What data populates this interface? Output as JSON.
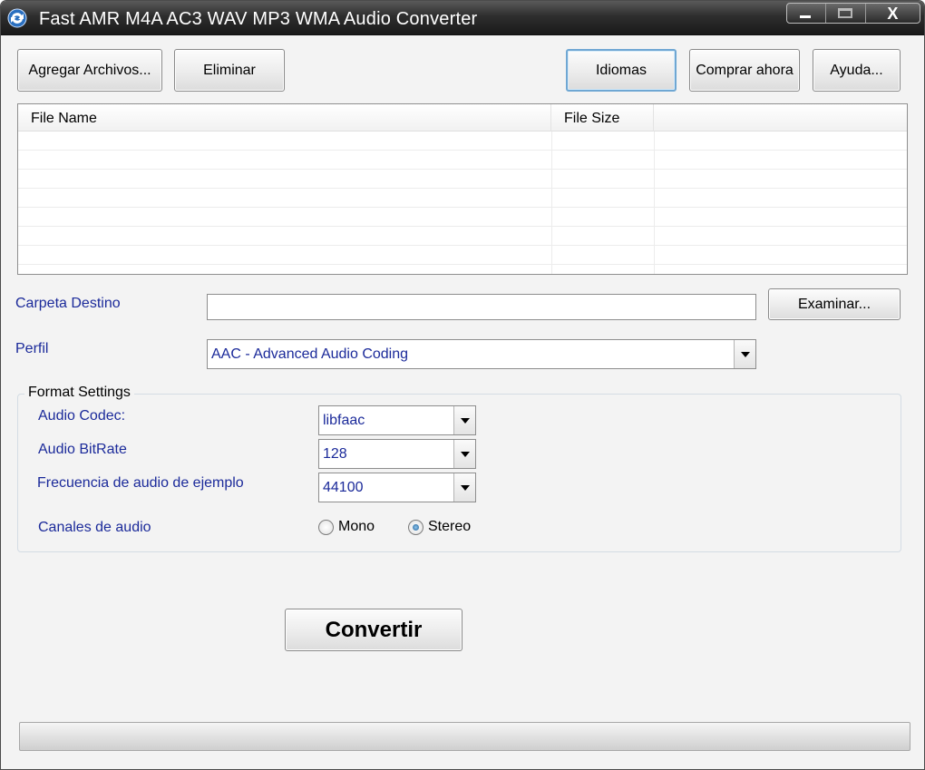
{
  "window": {
    "title": "Fast AMR M4A AC3 WAV MP3 WMA Audio Converter",
    "close_glyph": "X"
  },
  "toolbar": {
    "add_files": "Agregar Archivos...",
    "remove": "Eliminar",
    "languages": "Idiomas",
    "buy_now": "Comprar ahora",
    "help": "Ayuda..."
  },
  "file_list": {
    "columns": [
      "File Name",
      "File Size"
    ],
    "rows": []
  },
  "destination": {
    "label": "Carpeta Destino",
    "value": "",
    "browse": "Examinar..."
  },
  "profile": {
    "label": "Perfil",
    "selected": "AAC - Advanced Audio Coding"
  },
  "format_settings": {
    "title": "Format Settings",
    "audio_codec": {
      "label": "Audio Codec:",
      "selected": "libfaac"
    },
    "audio_bitrate": {
      "label": "Audio BitRate",
      "selected": "128"
    },
    "sample_rate": {
      "label": "Frecuencia de audio de ejemplo",
      "selected": "44100"
    },
    "channels": {
      "label": "Canales de audio",
      "options": [
        "Mono",
        "Stereo"
      ],
      "selected": "Stereo"
    }
  },
  "convert": {
    "label": "Convertir"
  },
  "progress": {
    "fraction": 0
  },
  "colors": {
    "label_text": "#1b2a9a",
    "focus_border": "#6fa7d3",
    "titlebar": "#2e2e2e"
  },
  "icons": {
    "app": "refresh-arrows-icon",
    "dropdown": "chevron-down-icon"
  }
}
